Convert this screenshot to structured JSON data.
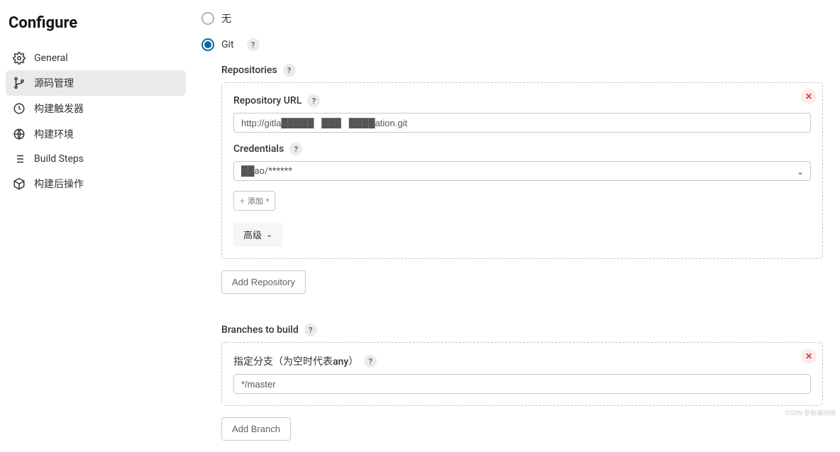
{
  "page": {
    "title": "Configure"
  },
  "sidebar": {
    "items": [
      {
        "label": "General"
      },
      {
        "label": "源码管理"
      },
      {
        "label": "构建触发器"
      },
      {
        "label": "构建环境"
      },
      {
        "label": "Build Steps"
      },
      {
        "label": "构建后操作"
      }
    ]
  },
  "scm": {
    "none_label": "无",
    "git_label": "Git",
    "repositories_label": "Repositories",
    "repo_url_label": "Repository URL",
    "repo_url_value": "http://gitla█████   ███   ████ation.git",
    "credentials_label": "Credentials",
    "credentials_value": "██ao/******",
    "add_cred_label": "添加",
    "advanced_label": "高级",
    "add_repo_label": "Add Repository",
    "branches_label": "Branches to build",
    "branch_spec_label": "指定分支（为空时代表any）",
    "branch_spec_value": "*/master",
    "add_branch_label": "Add Branch"
  },
  "help_glyph": "?",
  "watermark": "CSDN 参板编网络"
}
